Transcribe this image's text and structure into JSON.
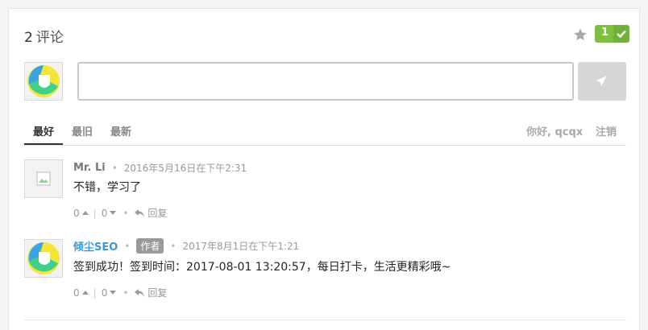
{
  "header": {
    "comment_count": "2",
    "comment_label": "评论",
    "recommend_count": "1"
  },
  "tabs": [
    {
      "label": "最好"
    },
    {
      "label": "最旧"
    },
    {
      "label": "最新"
    }
  ],
  "account": {
    "greeting": "你好, qcqx",
    "logout_label": "注销"
  },
  "comments": [
    {
      "author": "Mr. Li",
      "time": "2016年5月16日在下午2:31",
      "text": "不错，学习了",
      "upvotes": "0",
      "downvotes": "0",
      "reply_label": "回复"
    },
    {
      "author": "倾尘SEO",
      "badge": "作者",
      "time": "2017年8月1日在下午1:21",
      "text": "签到成功！签到时间：2017-08-01 13:20:57，每日打卡，生活更精彩哦~",
      "upvotes": "0",
      "downvotes": "0",
      "reply_label": "回复"
    }
  ],
  "colors": {
    "accent_green": "#7fbf3f",
    "author_link": "#3a99d8"
  }
}
